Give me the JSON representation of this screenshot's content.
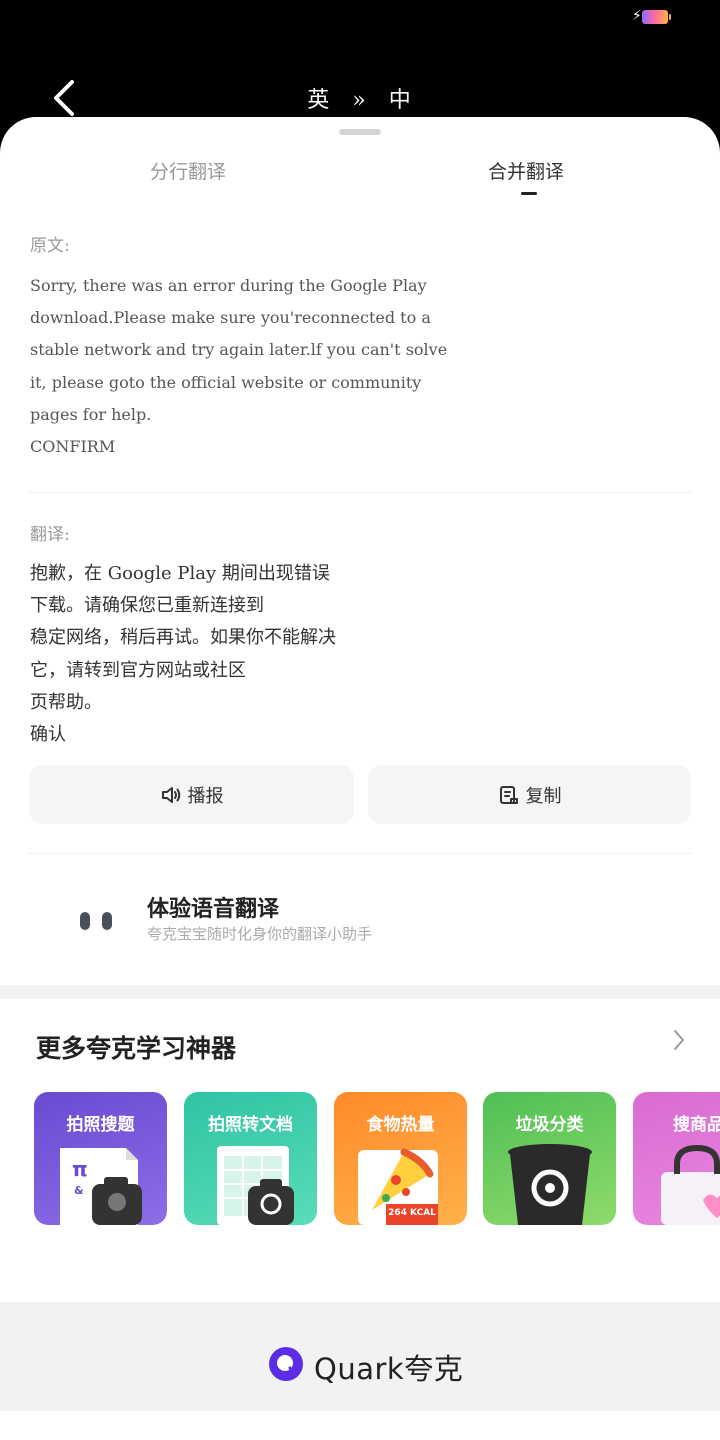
{
  "status_bar": {
    "battery_icon": "battery-charging-icon"
  },
  "header": {
    "back_icon": "chevron-left-icon",
    "source_lang": "英",
    "arrow": "»",
    "target_lang": "中"
  },
  "tabs": [
    {
      "label": "分行翻译",
      "active": false
    },
    {
      "label": "合并翻译",
      "active": true
    }
  ],
  "source": {
    "label": "原文:",
    "lines": [
      "Sorry,  there was an error during the Google Play",
      "download.Please make sure you'reconnected to a",
      "stable network and try again later.lf you can't solve",
      "it,  please goto the official website or community",
      "pages for help.",
      "CONFIRM"
    ]
  },
  "translation": {
    "label": "翻译:",
    "lines": [
      "抱歉，在 Google Play 期间出现错误",
      "下载。请确保您已重新连接到",
      "稳定网络，稍后再试。如果你不能解决",
      "它，请转到官方网站或社区",
      "页帮助。",
      "确认"
    ]
  },
  "actions": {
    "speak_label": "播报",
    "copy_label": "复制"
  },
  "voice_promo": {
    "title": "体验语音翻译",
    "subtitle": "夸克宝宝随时化身你的翻译小助手"
  },
  "more_tools": {
    "title": "更多夸克学习神器",
    "items": [
      {
        "label": "拍照搜题"
      },
      {
        "label": "拍照转文档"
      },
      {
        "label": "食物热量",
        "badge": "264 KCAL"
      },
      {
        "label": "垃圾分类"
      },
      {
        "label": "搜商品"
      }
    ]
  },
  "footer": {
    "brand": "Quark夸克"
  },
  "colors": {
    "accent": "#5b2ee6",
    "background_dark": "#000000"
  }
}
